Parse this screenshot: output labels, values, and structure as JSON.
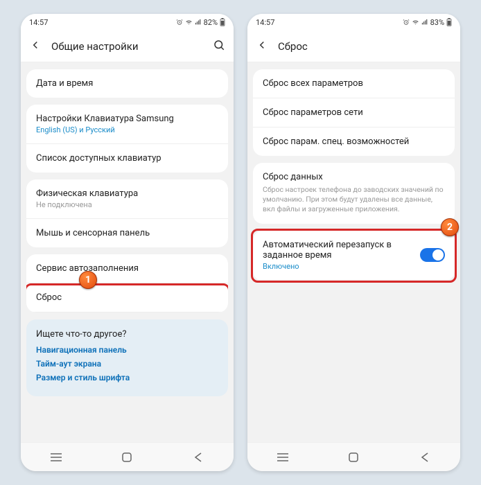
{
  "left": {
    "status": {
      "time": "14:57",
      "battery": "82%"
    },
    "header": {
      "title": "Общие настройки"
    },
    "rows": {
      "datetime": {
        "label": "Дата и время"
      },
      "samsung_kb": {
        "label": "Настройки Клавиатура Samsung",
        "sub": "English (US) и Русский"
      },
      "kb_list": {
        "label": "Список доступных клавиатур"
      },
      "phys_kb": {
        "label": "Физическая клавиатура",
        "sub": "Не подключена"
      },
      "mouse": {
        "label": "Мышь и сенсорная панель"
      },
      "autofill": {
        "label": "Сервис автозаполнения"
      },
      "reset": {
        "label": "Сброс"
      }
    },
    "suggest": {
      "title": "Ищете что-то другое?",
      "links": {
        "nav": "Навигационная панель",
        "timeout": "Тайм-аут экрана",
        "font": "Размер и стиль шрифта"
      }
    },
    "marker": "1"
  },
  "right": {
    "status": {
      "time": "14:57",
      "battery": "83%"
    },
    "header": {
      "title": "Сброс"
    },
    "rows": {
      "all": {
        "label": "Сброс всех параметров"
      },
      "network": {
        "label": "Сброс параметров сети"
      },
      "access": {
        "label": "Сброс парам. спец. возможностей"
      },
      "data": {
        "label": "Сброс данных",
        "desc": "Сброс настроек телефона до заводских значений по умолчанию. При этом будут удалены все данные, вкл файлы и загруженные приложения."
      },
      "auto": {
        "label": "Автоматический перезапуск в заданное время",
        "sub": "Включено"
      }
    },
    "marker": "2"
  }
}
